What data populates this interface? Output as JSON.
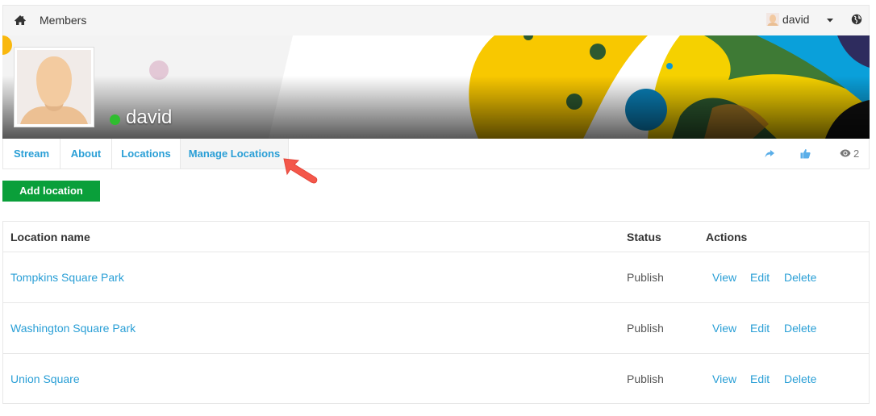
{
  "topbar": {
    "home_icon": "home-icon",
    "brand": "Members",
    "user_name": "david",
    "caret_icon": "caret-down-icon",
    "globe_icon": "globe-icon"
  },
  "profile": {
    "name": "david",
    "status": "online",
    "status_color": "#2fbd2f"
  },
  "tabs": [
    {
      "label": "Stream"
    },
    {
      "label": "About"
    },
    {
      "label": "Locations"
    },
    {
      "label": "Manage Locations",
      "active": true
    }
  ],
  "tab_actions": {
    "share_icon": "share-icon",
    "like_icon": "thumbs-up-icon",
    "views_icon": "eye-icon",
    "views_count": "2"
  },
  "add_button": {
    "label": "Add location",
    "color": "#0a9f3a"
  },
  "table": {
    "columns": [
      "Location name",
      "Status",
      "Actions"
    ],
    "rows": [
      {
        "name": "Tompkins Square Park",
        "status": "Publish",
        "actions": [
          "View",
          "Edit",
          "Delete"
        ]
      },
      {
        "name": "Washington Square Park",
        "status": "Publish",
        "actions": [
          "View",
          "Edit",
          "Delete"
        ]
      },
      {
        "name": "Union Square",
        "status": "Publish",
        "actions": [
          "View",
          "Edit",
          "Delete"
        ]
      }
    ]
  },
  "colors": {
    "link": "#2a9fd6",
    "annotation_arrow": "#f4574a"
  }
}
